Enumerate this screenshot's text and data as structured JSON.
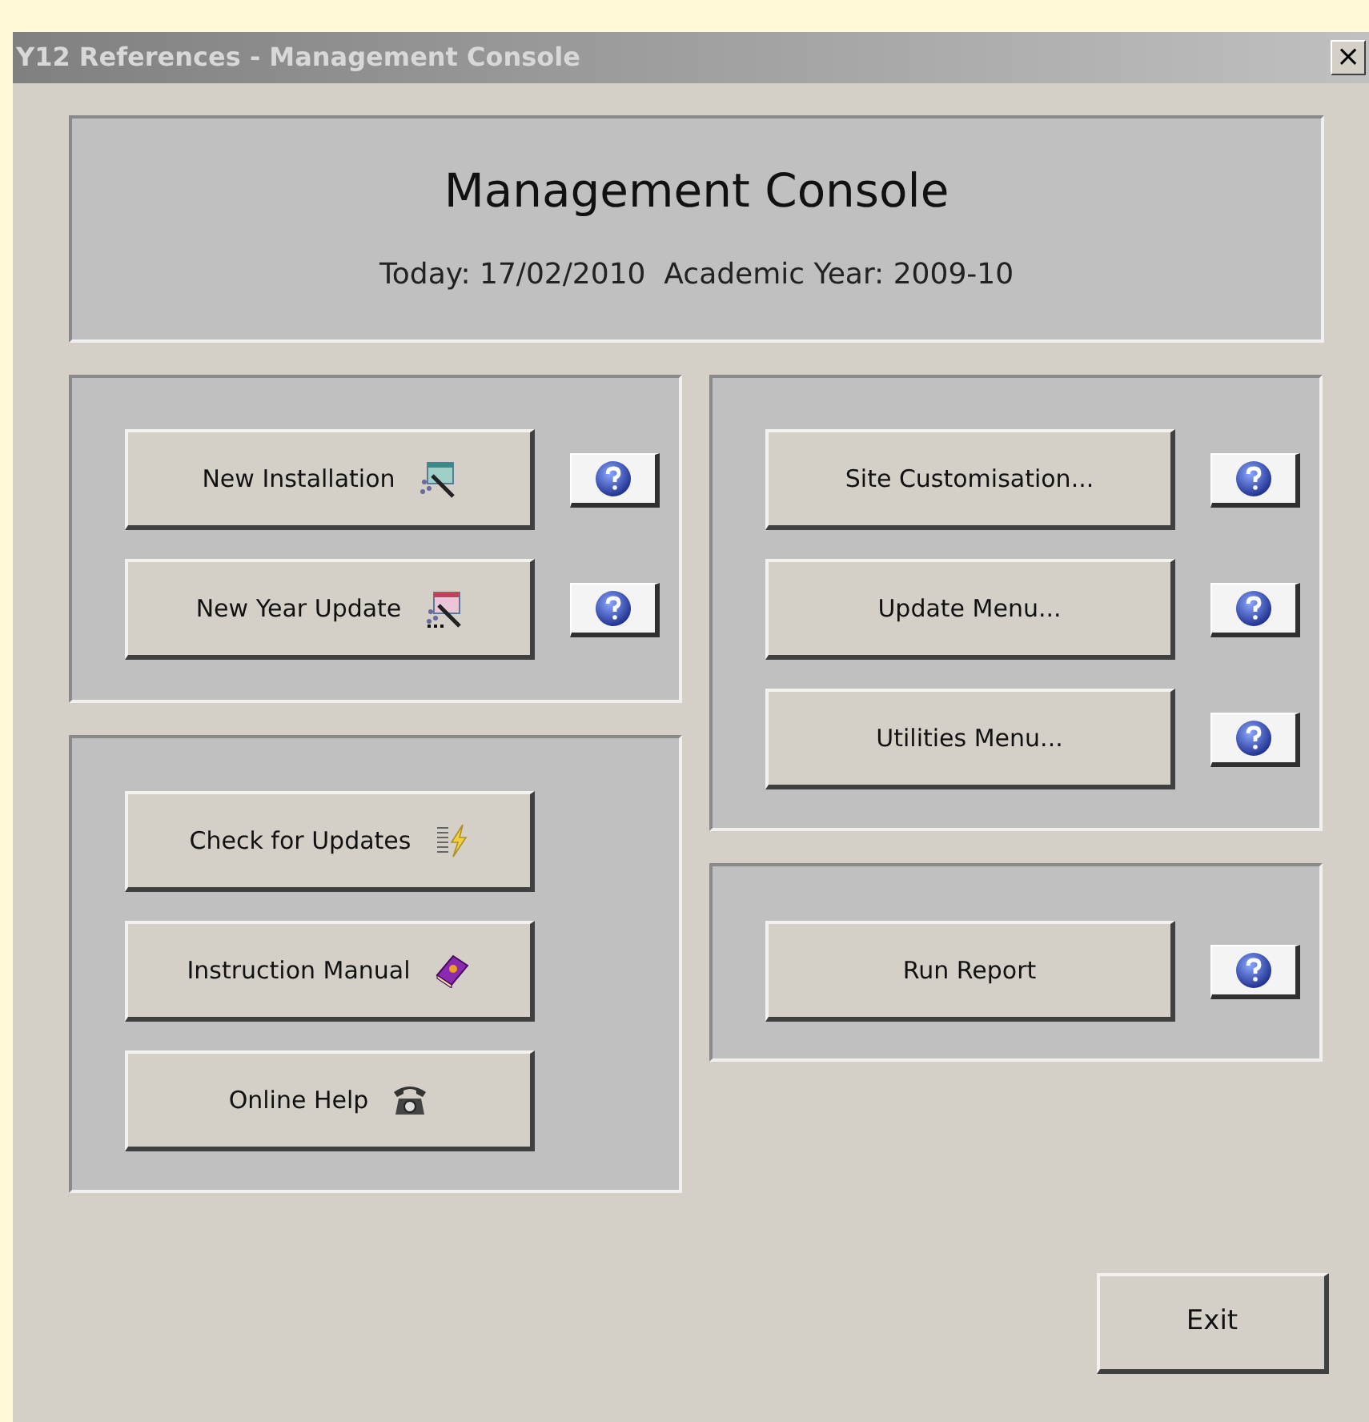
{
  "window": {
    "title": "Y12 References - Management Console",
    "close": "×"
  },
  "header": {
    "title": "Management Console",
    "subtitle": "Today: 17/02/2010  Academic Year: 2009-10"
  },
  "left_panels": [
    {
      "rows": [
        {
          "label": "New Installation",
          "kind": "wizard",
          "help": true
        },
        {
          "label": "New Year Update",
          "kind": "wizard-update",
          "help": true
        }
      ]
    },
    {
      "rows": [
        {
          "label": "Check for Updates",
          "kind": "lightning",
          "help": false
        },
        {
          "label": "Instruction Manual",
          "kind": "book",
          "help": false
        },
        {
          "label": "Online Help",
          "kind": "phone",
          "help": false
        }
      ]
    }
  ],
  "right_panels": [
    {
      "rows": [
        {
          "label": "Site Customisation...",
          "help": true
        },
        {
          "label": "Update Menu...",
          "help": true
        },
        {
          "label": "Utilities Menu...",
          "help": true
        }
      ]
    },
    {
      "rows": [
        {
          "label": "Run Report",
          "help": true
        }
      ]
    }
  ],
  "exit_button": "Exit"
}
